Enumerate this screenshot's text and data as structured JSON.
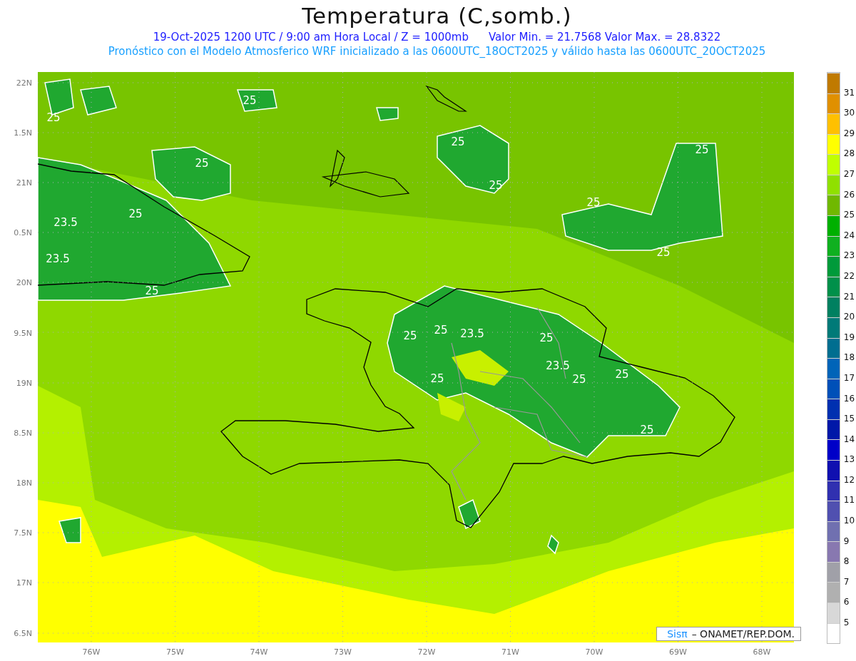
{
  "title": "Temperatura (C,somb.)",
  "info_line": {
    "left": "19-Oct-2025  1200 UTC / 9:00 am Hora Local / Z = 1000mb",
    "right": "Valor Min. = 21.7568  Valor Max. = 28.8322"
  },
  "forecast_line": "Pronóstico con el Modelo Atmosferico WRF inicializado a las 0600UTC_18OCT2025 y válido hasta las  0600UTC_20OCT2025",
  "y_axis_labels": [
    "22N",
    "1.5N",
    "21N",
    "0.5N",
    "20N",
    "9.5N",
    "19N",
    "8.5N",
    "18N",
    "7.5N",
    "17N",
    "6.5N"
  ],
  "x_axis_labels": [
    "76W",
    "75W",
    "74W",
    "73W",
    "72W",
    "71W",
    "70W",
    "69W",
    "68W"
  ],
  "contour_labels": [
    "25",
    "25",
    "25",
    "25",
    "25",
    "25",
    "25",
    "25",
    "23.5",
    "23.5",
    "25",
    "25",
    "25",
    "25",
    "23.5",
    "25",
    "23.5",
    "25",
    "25",
    "25",
    "25"
  ],
  "credit": {
    "logo": "Sisπ",
    "text": "– ONAMET/REP.DOM."
  },
  "colorbar": {
    "segments": [
      {
        "color": "#c07a00"
      },
      {
        "color": "#e09000"
      },
      {
        "color": "#ffc000"
      },
      {
        "color": "#ffff00"
      },
      {
        "color": "#c0ff00"
      },
      {
        "color": "#90e000"
      },
      {
        "color": "#70b800"
      },
      {
        "color": "#00b000"
      },
      {
        "color": "#10b020"
      },
      {
        "color": "#009a3a"
      },
      {
        "color": "#00904a"
      },
      {
        "color": "#008060"
      },
      {
        "color": "#007a78"
      },
      {
        "color": "#006e90"
      },
      {
        "color": "#0064b8"
      },
      {
        "color": "#0050b8"
      },
      {
        "color": "#0030b0"
      },
      {
        "color": "#0018a8"
      },
      {
        "color": "#0000c8"
      },
      {
        "color": "#1010b0"
      },
      {
        "color": "#3030b0"
      },
      {
        "color": "#5050b0"
      },
      {
        "color": "#7070b0"
      },
      {
        "color": "#8878b0"
      },
      {
        "color": "#a0a0a8"
      },
      {
        "color": "#b0b0b0"
      },
      {
        "color": "#d8d8d8"
      },
      {
        "color": "#ffffff"
      }
    ],
    "labels": [
      "31",
      "30",
      "29",
      "28",
      "27",
      "26",
      "25",
      "24",
      "23",
      "22",
      "21",
      "20",
      "19",
      "18",
      "17",
      "16",
      "15",
      "14",
      "13",
      "12",
      "11",
      "10",
      "9",
      "8",
      "7",
      "6",
      "5"
    ]
  }
}
